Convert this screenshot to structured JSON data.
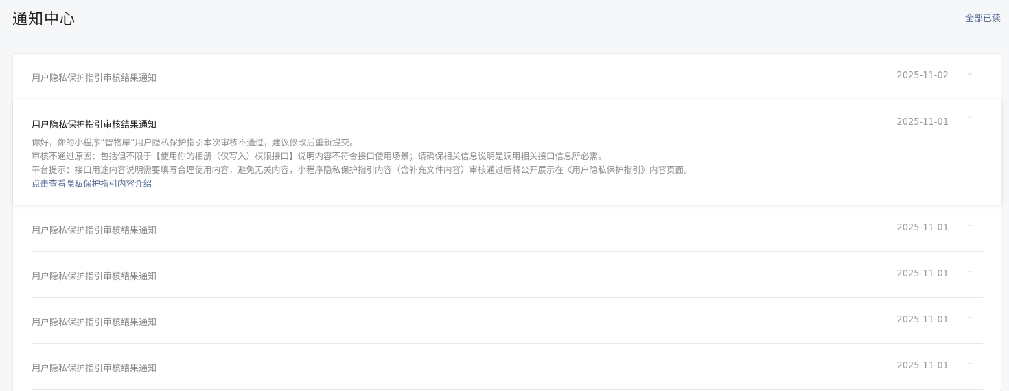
{
  "header": {
    "title": "通知中心",
    "mark_all_read": "全部已读"
  },
  "icons": {
    "collapsed": "chevron-down-icon",
    "expanded": "chevron-up-icon"
  },
  "notifications": [
    {
      "title": "用户隐私保护指引审核结果通知",
      "date": "2025-11-02",
      "expanded": false
    },
    {
      "title": "用户隐私保护指引审核结果通知",
      "date": "2025-11-01",
      "expanded": true,
      "body": {
        "line1": "你好，你的小程序“智物岸”用户隐私保护指引本次审核不通过，建议修改后重新提交。",
        "line2": "审核不通过原因：包括但不限于【使用你的相册（仅写入）权限接口】说明内容不符合接口使用场景；请确保相关信息说明是调用相关接口信息所必需。",
        "line3": "平台提示：接口用途内容说明需要填写合理使用内容，避免无关内容，小程序隐私保护指引内容（含补充文件内容）审核通过后将公开展示在《用户隐私保护指引》内容页面。",
        "link": "点击查看隐私保护指引内容介绍"
      }
    },
    {
      "title": "用户隐私保护指引审核结果通知",
      "date": "2025-11-01",
      "expanded": false
    },
    {
      "title": "用户隐私保护指引审核结果通知",
      "date": "2025-11-01",
      "expanded": false
    },
    {
      "title": "用户隐私保护指引审核结果通知",
      "date": "2025-11-01",
      "expanded": false
    },
    {
      "title": "用户隐私保护指引审核结果通知",
      "date": "2025-11-01",
      "expanded": false
    }
  ]
}
